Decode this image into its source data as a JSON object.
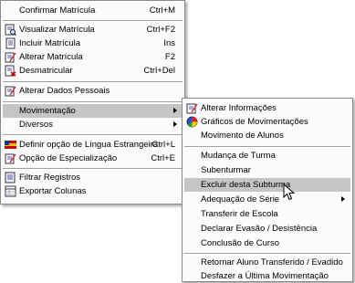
{
  "main_menu": {
    "confirmar_matricula": {
      "label": "Confirmar Matrícula",
      "shortcut": "Ctrl+M"
    },
    "visualizar_matricula": {
      "label": "Visualizar Matrícula",
      "shortcut": "Ctrl+F2"
    },
    "incluir_matricula": {
      "label": "Incluir Matrícula",
      "shortcut": "Ins"
    },
    "alterar_matricula": {
      "label": "Alterar Matrícula",
      "shortcut": "F2"
    },
    "desmatricular": {
      "label": "Desmatricular",
      "shortcut": "Ctrl+Del"
    },
    "alterar_dados_pessoais": {
      "label": "Alterar Dados Pessoais"
    },
    "movimentacao": {
      "label": "Movimentação"
    },
    "diversos": {
      "label": "Diversos"
    },
    "definir_lingua": {
      "label": "Definir opção de Língua Estrangeira",
      "shortcut": "Ctrl+L"
    },
    "opcao_especializacao": {
      "label": "Opção de Especialização",
      "shortcut": "Ctrl+E"
    },
    "filtrar_registros": {
      "label": "Filtrar Registros"
    },
    "exportar_colunas": {
      "label": "Exportar Colunas"
    }
  },
  "sub_menu": {
    "alterar_informacoes": {
      "label": "Alterar Informações"
    },
    "graficos_movimentacoes": {
      "label": "Gráficos de Movimentações"
    },
    "movimento_alunos": {
      "label": "Movimento de Alunos"
    },
    "mudanca_turma": {
      "label": "Mudança de Turma"
    },
    "subenturmar": {
      "label": "Subenturmar"
    },
    "excluir_subturma": {
      "label": "Excluir desta Subturma"
    },
    "adequacao_serie": {
      "label": "Adequação de Série"
    },
    "transferir_escola": {
      "label": "Transferir de Escola"
    },
    "declarar_evasao": {
      "label": "Declarar Evasão / Desistência"
    },
    "conclusao_curso": {
      "label": "Conclusão de Curso"
    },
    "retornar_aluno": {
      "label": "Retornar Aluno Transferido / Evadido"
    },
    "desfazer_movimentacao": {
      "label": "Desfazer a Última Movimentação"
    }
  },
  "highlighted": {
    "main": "Movimentação",
    "sub": "Excluir desta Subturma"
  },
  "colors": {
    "highlight": "#c5c5c5",
    "menu_bg": "#fbfbfb",
    "border": "#8a8a8a"
  }
}
